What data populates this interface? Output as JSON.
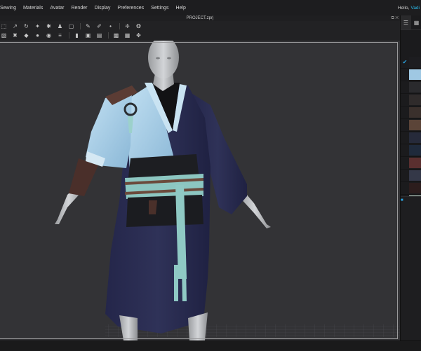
{
  "menu": [
    "Sewing",
    "Materials",
    "Avatar",
    "Render",
    "Display",
    "Preferences",
    "Settings",
    "Help"
  ],
  "user": {
    "greeting": "Hello,",
    "name": "Vadi"
  },
  "window": {
    "title": "PROJECT.zprj"
  },
  "toolbar": {
    "row1_icons": [
      "transform-pattern-icon",
      "edit-pattern-icon",
      "fold-arrangement-icon",
      "segment-sewing-icon",
      "free-sewing-icon",
      "avatar-tool-icon",
      "selection-icon",
      "brush-icon",
      "pencil-icon",
      "point-icon",
      "simulation-icon",
      "texture-icon"
    ],
    "row2_icons": [
      "tack-icon",
      "pin-icon",
      "shape-icon",
      "sphere-icon",
      "button-icon",
      "zipper-icon",
      "measure-icon",
      "hanger-icon",
      "fabric-icon",
      "group-icon",
      "ungroup-icon",
      "move-icon"
    ]
  },
  "right_panel": {
    "tabs": [
      "list-icon",
      "fabric-icon"
    ],
    "swatches": [
      {
        "color": "#1d1d20",
        "checked": true
      },
      {
        "color": "#9fc8e3",
        "checked": false
      },
      {
        "color": "#2a2a2d",
        "checked": false
      },
      {
        "color": "#2f2b2b",
        "checked": false
      },
      {
        "color": "#3a302c",
        "checked": false
      },
      {
        "color": "#5b4438",
        "checked": false
      },
      {
        "color": "#262a3a",
        "checked": false
      },
      {
        "color": "#1f2a3b",
        "checked": false
      },
      {
        "color": "#5a2f2f",
        "checked": false
      },
      {
        "color": "#343848",
        "checked": false
      },
      {
        "color": "#2c1d1d",
        "checked": false
      },
      {
        "color": "#bcd2c6",
        "checked": false
      }
    ]
  },
  "colors": {
    "accent": "#2aa7e6",
    "viewport_bg": "#333336",
    "robe_dark": "#2a2c4e",
    "robe_light": "#a9cfe8",
    "sash": "#8ec6c0"
  }
}
